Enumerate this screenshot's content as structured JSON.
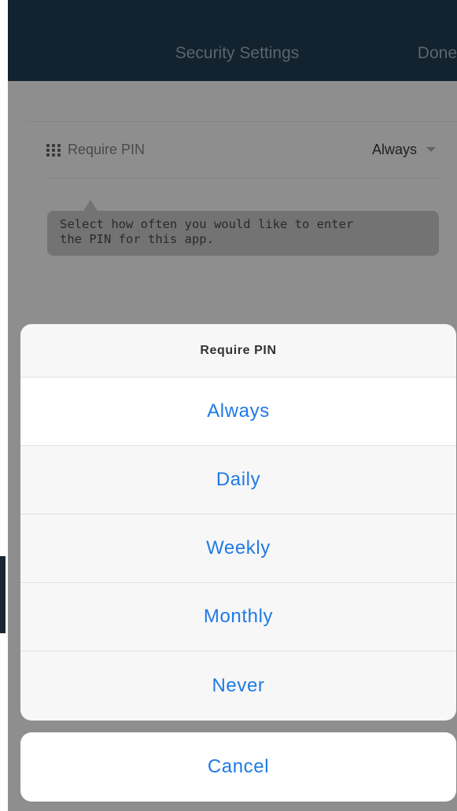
{
  "nav": {
    "title": "Security Settings",
    "done_label": "Done"
  },
  "setting_row": {
    "icon": "grid-icon",
    "label": "Require PIN",
    "value": "Always"
  },
  "tooltip": {
    "line1": "Select how often you would like to enter",
    "line2": "the PIN for this app."
  },
  "action_sheet": {
    "title": "Require PIN",
    "options": [
      "Always",
      "Daily",
      "Weekly",
      "Monthly",
      "Never"
    ],
    "selected": "Always",
    "cancel_label": "Cancel"
  },
  "colors": {
    "navbar": "#12222e",
    "dim_overlay": "#8e8e8e",
    "accent": "#1f7ae6"
  }
}
